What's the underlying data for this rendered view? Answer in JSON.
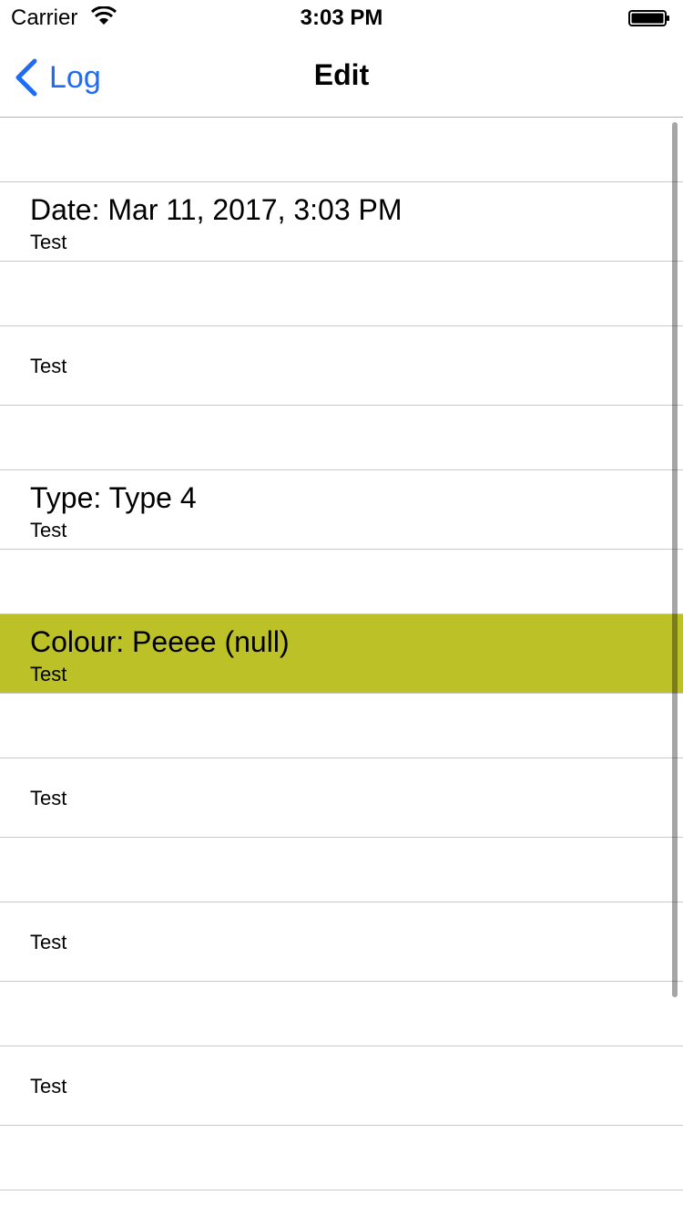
{
  "status_bar": {
    "carrier": "Carrier",
    "time": "3:03 PM"
  },
  "nav": {
    "back_label": "Log",
    "title": "Edit"
  },
  "rows": [
    {
      "title": "Date: Mar 11, 2017, 3:03 PM",
      "subtitle": "Test"
    },
    {
      "subtitle": "Test"
    },
    {
      "title": "Type: Type 4",
      "subtitle": "Test"
    },
    {
      "title": "Colour: Peeee (null)",
      "subtitle": "Test",
      "highlight_color": "#bdc128"
    },
    {
      "subtitle": "Test"
    },
    {
      "subtitle": "Test"
    },
    {
      "subtitle": "Test"
    }
  ],
  "colors": {
    "accent": "#1e6bf5",
    "separator": "#c8c8cc"
  }
}
